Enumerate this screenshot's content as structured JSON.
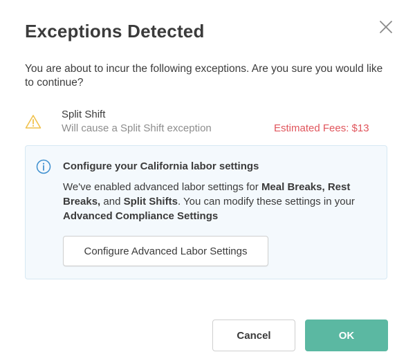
{
  "dialog": {
    "title": "Exceptions Detected",
    "close_icon": "close-icon",
    "intro": "You are about to incur the following exceptions. Are you sure you would like to continue?"
  },
  "exception": {
    "icon": "warning-triangle-icon",
    "name": "Split Shift",
    "description": "Will cause a Split Shift exception",
    "fees": "Estimated Fees: $13"
  },
  "info": {
    "icon": "info-icon",
    "title": "Configure your California labor settings",
    "text": {
      "t1": "We've enabled advanced labor settings for ",
      "b1": "Meal Breaks, Rest Breaks,",
      "t2": " and ",
      "b2": "Split Shifts",
      "t3": ". You can modify these settings in your ",
      "b3": "Advanced Compliance Settings"
    },
    "button_label": "Configure Advanced Labor Settings"
  },
  "actions": {
    "cancel_label": "Cancel",
    "ok_label": "OK"
  },
  "colors": {
    "accent": "#5bb8a2",
    "fees": "#e0545b",
    "warning": "#f0c14b",
    "info": "#3d8fcf",
    "info_bg": "#f4f9fd"
  }
}
